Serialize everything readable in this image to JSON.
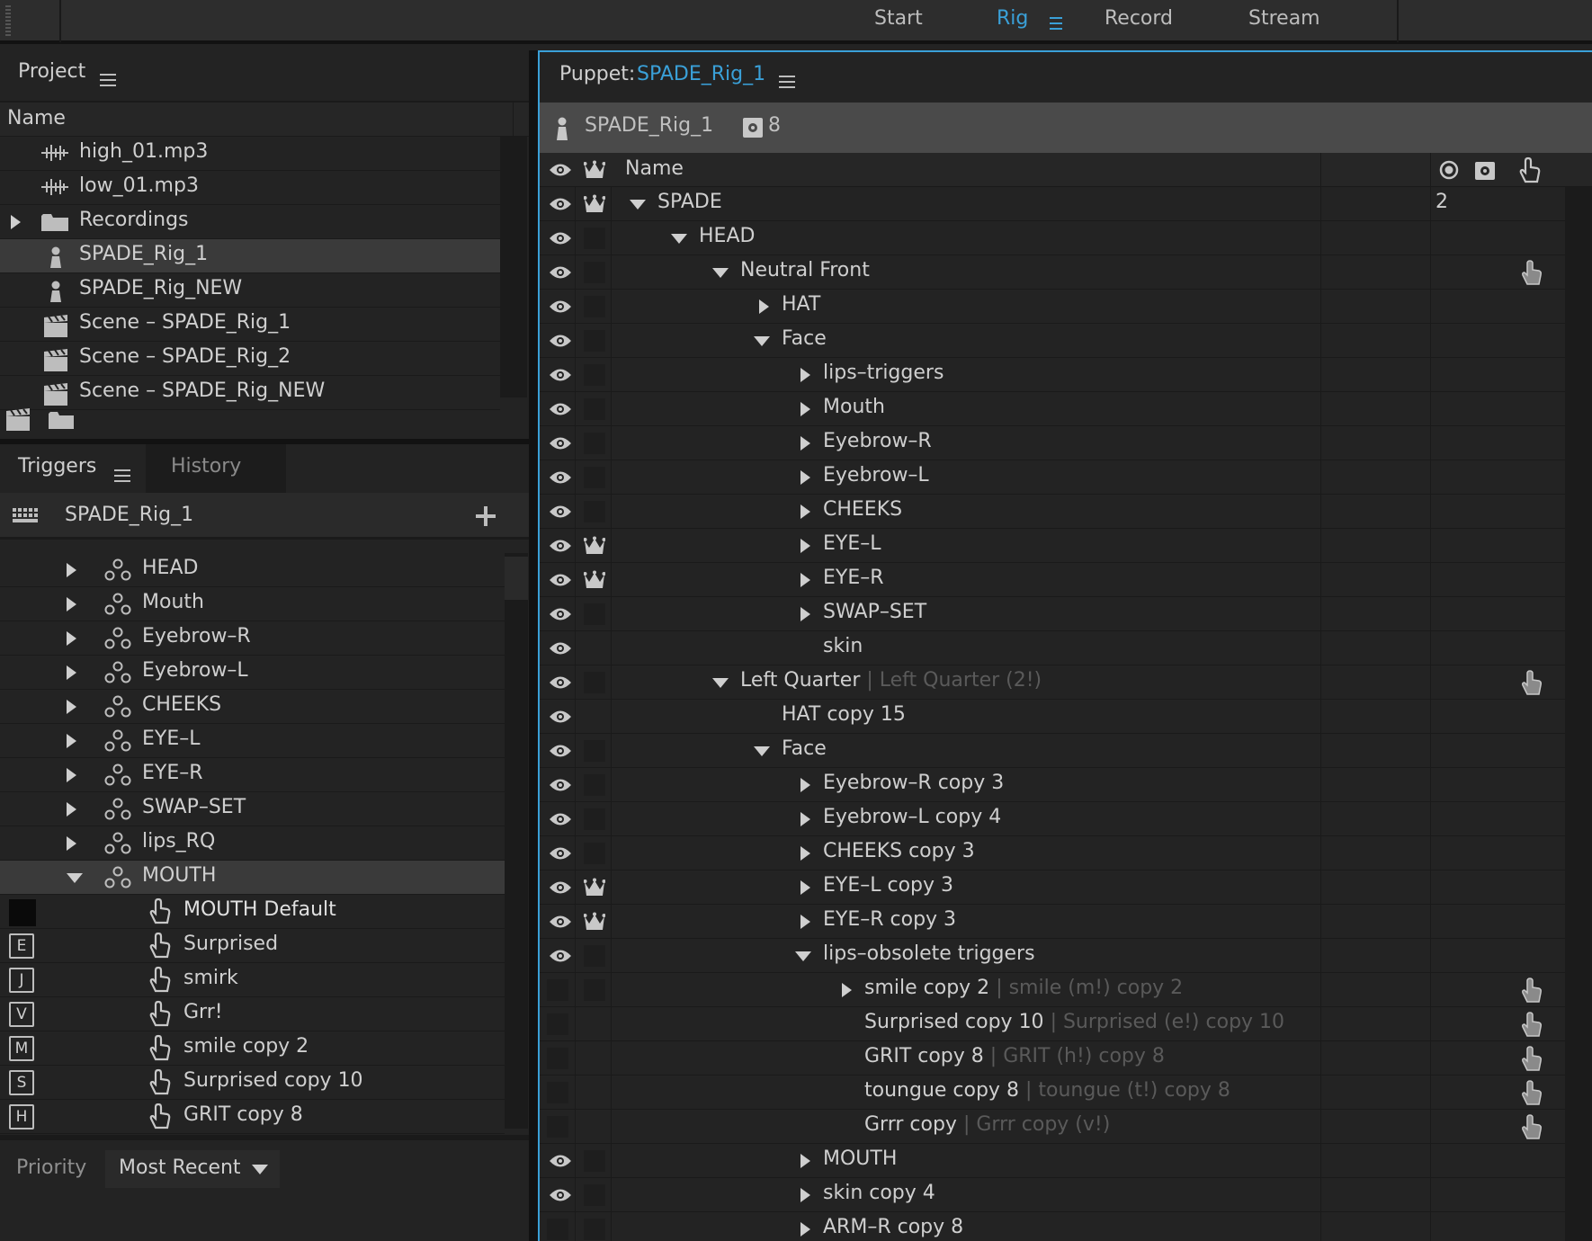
{
  "topbar": {
    "tabs": [
      {
        "label": "Start"
      },
      {
        "label": "Rig"
      },
      {
        "label": "Record"
      },
      {
        "label": "Stream"
      }
    ]
  },
  "project": {
    "title": "Project",
    "column": "Name",
    "items": [
      {
        "label": "high_01.mp3",
        "icon": "audio-icon"
      },
      {
        "label": "low_01.mp3",
        "icon": "audio-icon"
      },
      {
        "label": "Recordings",
        "icon": "folder-icon"
      },
      {
        "label": "SPADE_Rig_1",
        "icon": "puppet-icon"
      },
      {
        "label": "SPADE_Rig_NEW",
        "icon": "puppet-icon"
      },
      {
        "label": "Scene – SPADE_Rig_1",
        "icon": "scene-icon"
      },
      {
        "label": "Scene – SPADE_Rig_2",
        "icon": "scene-icon"
      },
      {
        "label": "Scene – SPADE_Rig_NEW",
        "icon": "scene-icon"
      }
    ]
  },
  "triggers": {
    "tab_triggers": "Triggers",
    "tab_history": "History",
    "puppet": "SPADE_Rig_1",
    "groups": [
      "HEAD",
      "Mouth",
      "Eyebrow–R",
      "Eyebrow–L",
      "CHEEKS",
      "EYE–L",
      "EYE–R",
      "SWAP–SET",
      "lips_RQ",
      "MOUTH"
    ],
    "items": [
      {
        "key": "",
        "label": "MOUTH Default"
      },
      {
        "key": "E",
        "label": "Surprised"
      },
      {
        "key": "J",
        "label": "smirk"
      },
      {
        "key": "V",
        "label": "Grr!"
      },
      {
        "key": "M",
        "label": "smile  copy 2"
      },
      {
        "key": "S",
        "label": "Surprised  copy 10"
      },
      {
        "key": "H",
        "label": "GRIT  copy 8"
      }
    ],
    "priority_label": "Priority",
    "priority_value": "Most Recent"
  },
  "puppet": {
    "title_prefix": "Puppet:",
    "title_name": "SPADE_Rig_1",
    "header_name": "SPADE_Rig_1",
    "header_count": "8",
    "column_name": "Name",
    "spade_count": "2",
    "rows": [
      {
        "label": "SPADE",
        "sub": ""
      },
      {
        "label": "HEAD",
        "sub": ""
      },
      {
        "label": "Neutral Front",
        "sub": ""
      },
      {
        "label": "HAT",
        "sub": ""
      },
      {
        "label": "Face",
        "sub": ""
      },
      {
        "label": "lips–triggers",
        "sub": ""
      },
      {
        "label": "Mouth",
        "sub": ""
      },
      {
        "label": "Eyebrow–R",
        "sub": ""
      },
      {
        "label": "Eyebrow–L",
        "sub": ""
      },
      {
        "label": "CHEEKS",
        "sub": ""
      },
      {
        "label": "EYE–L",
        "sub": ""
      },
      {
        "label": "EYE–R",
        "sub": ""
      },
      {
        "label": "SWAP–SET",
        "sub": ""
      },
      {
        "label": "skin",
        "sub": ""
      },
      {
        "label": "Left Quarter",
        "sub": "| Left Quarter (2!)"
      },
      {
        "label": "HAT copy 15",
        "sub": ""
      },
      {
        "label": "Face",
        "sub": ""
      },
      {
        "label": "Eyebrow–R copy 3",
        "sub": ""
      },
      {
        "label": "Eyebrow–L copy 4",
        "sub": ""
      },
      {
        "label": "CHEEKS copy 3",
        "sub": ""
      },
      {
        "label": "EYE–L copy 3",
        "sub": ""
      },
      {
        "label": "EYE–R copy 3",
        "sub": ""
      },
      {
        "label": "lips–obsolete triggers",
        "sub": ""
      },
      {
        "label": "smile  copy 2",
        "sub": "| smile (m!) copy 2"
      },
      {
        "label": "Surprised  copy 10",
        "sub": "| Surprised (e!) copy 10"
      },
      {
        "label": "GRIT  copy 8",
        "sub": "| GRIT (h!) copy 8"
      },
      {
        "label": "toungue  copy 8",
        "sub": "| toungue (t!) copy 8"
      },
      {
        "label": "Grrr copy",
        "sub": "| Grrr copy (v!)"
      },
      {
        "label": "MOUTH",
        "sub": ""
      },
      {
        "label": "skin copy 4",
        "sub": ""
      },
      {
        "label": "ARM–R copy 8",
        "sub": ""
      }
    ]
  },
  "colors": {
    "accent": "#3aa0d8",
    "bg": "#232323"
  }
}
